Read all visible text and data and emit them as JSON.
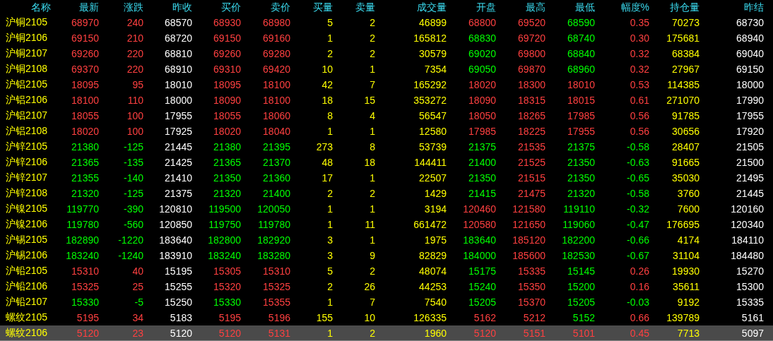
{
  "columns": [
    "名称",
    "最新",
    "涨跌",
    "昨收",
    "买价",
    "卖价",
    "买量",
    "卖量",
    "成交量",
    "开盘",
    "最高",
    "最低",
    "幅度%",
    "持仓量",
    "昨结"
  ],
  "rows": [
    {
      "name": "沪铜2105",
      "selected": false,
      "cells": [
        {
          "text": "68970",
          "color": "#ff4040"
        },
        {
          "text": "240",
          "color": "#ff4040"
        },
        {
          "text": "68570",
          "color": "#ffffff"
        },
        {
          "text": "68930",
          "color": "#ff4040"
        },
        {
          "text": "68980",
          "color": "#ff4040"
        },
        {
          "text": "5",
          "color": "#ffff00"
        },
        {
          "text": "2",
          "color": "#ffff00"
        },
        {
          "text": "46899",
          "color": "#ffff00"
        },
        {
          "text": "68800",
          "color": "#ff4040"
        },
        {
          "text": "69520",
          "color": "#ff4040"
        },
        {
          "text": "68590",
          "color": "#00ff00"
        },
        {
          "text": "0.35",
          "color": "#ff4040"
        },
        {
          "text": "70273",
          "color": "#ffff00"
        },
        {
          "text": "68730",
          "color": "#ffffff"
        }
      ]
    },
    {
      "name": "沪铜2106",
      "selected": false,
      "cells": [
        {
          "text": "69150",
          "color": "#ff4040"
        },
        {
          "text": "210",
          "color": "#ff4040"
        },
        {
          "text": "68720",
          "color": "#ffffff"
        },
        {
          "text": "69150",
          "color": "#ff4040"
        },
        {
          "text": "69160",
          "color": "#ff4040"
        },
        {
          "text": "1",
          "color": "#ffff00"
        },
        {
          "text": "2",
          "color": "#ffff00"
        },
        {
          "text": "165812",
          "color": "#ffff00"
        },
        {
          "text": "68830",
          "color": "#00ff00"
        },
        {
          "text": "69720",
          "color": "#ff4040"
        },
        {
          "text": "68740",
          "color": "#00ff00"
        },
        {
          "text": "0.30",
          "color": "#ff4040"
        },
        {
          "text": "175681",
          "color": "#ffff00"
        },
        {
          "text": "68940",
          "color": "#ffffff"
        }
      ]
    },
    {
      "name": "沪铜2107",
      "selected": false,
      "cells": [
        {
          "text": "69260",
          "color": "#ff4040"
        },
        {
          "text": "220",
          "color": "#ff4040"
        },
        {
          "text": "68810",
          "color": "#ffffff"
        },
        {
          "text": "69260",
          "color": "#ff4040"
        },
        {
          "text": "69280",
          "color": "#ff4040"
        },
        {
          "text": "2",
          "color": "#ffff00"
        },
        {
          "text": "2",
          "color": "#ffff00"
        },
        {
          "text": "30579",
          "color": "#ffff00"
        },
        {
          "text": "69020",
          "color": "#00ff00"
        },
        {
          "text": "69800",
          "color": "#ff4040"
        },
        {
          "text": "68840",
          "color": "#00ff00"
        },
        {
          "text": "0.32",
          "color": "#ff4040"
        },
        {
          "text": "68384",
          "color": "#ffff00"
        },
        {
          "text": "69040",
          "color": "#ffffff"
        }
      ]
    },
    {
      "name": "沪铜2108",
      "selected": false,
      "cells": [
        {
          "text": "69370",
          "color": "#ff4040"
        },
        {
          "text": "220",
          "color": "#ff4040"
        },
        {
          "text": "68910",
          "color": "#ffffff"
        },
        {
          "text": "69310",
          "color": "#ff4040"
        },
        {
          "text": "69420",
          "color": "#ff4040"
        },
        {
          "text": "10",
          "color": "#ffff00"
        },
        {
          "text": "1",
          "color": "#ffff00"
        },
        {
          "text": "7354",
          "color": "#ffff00"
        },
        {
          "text": "69050",
          "color": "#00ff00"
        },
        {
          "text": "69870",
          "color": "#ff4040"
        },
        {
          "text": "68960",
          "color": "#00ff00"
        },
        {
          "text": "0.32",
          "color": "#ff4040"
        },
        {
          "text": "27967",
          "color": "#ffff00"
        },
        {
          "text": "69150",
          "color": "#ffffff"
        }
      ]
    },
    {
      "name": "沪铝2105",
      "selected": false,
      "cells": [
        {
          "text": "18095",
          "color": "#ff4040"
        },
        {
          "text": "95",
          "color": "#ff4040"
        },
        {
          "text": "18010",
          "color": "#ffffff"
        },
        {
          "text": "18095",
          "color": "#ff4040"
        },
        {
          "text": "18100",
          "color": "#ff4040"
        },
        {
          "text": "42",
          "color": "#ffff00"
        },
        {
          "text": "7",
          "color": "#ffff00"
        },
        {
          "text": "165292",
          "color": "#ffff00"
        },
        {
          "text": "18020",
          "color": "#ff4040"
        },
        {
          "text": "18300",
          "color": "#ff4040"
        },
        {
          "text": "18010",
          "color": "#ff4040"
        },
        {
          "text": "0.53",
          "color": "#ff4040"
        },
        {
          "text": "114385",
          "color": "#ffff00"
        },
        {
          "text": "18000",
          "color": "#ffffff"
        }
      ]
    },
    {
      "name": "沪铝2106",
      "selected": false,
      "cells": [
        {
          "text": "18100",
          "color": "#ff4040"
        },
        {
          "text": "110",
          "color": "#ff4040"
        },
        {
          "text": "18000",
          "color": "#ffffff"
        },
        {
          "text": "18090",
          "color": "#ff4040"
        },
        {
          "text": "18100",
          "color": "#ff4040"
        },
        {
          "text": "18",
          "color": "#ffff00"
        },
        {
          "text": "15",
          "color": "#ffff00"
        },
        {
          "text": "353272",
          "color": "#ffff00"
        },
        {
          "text": "18090",
          "color": "#ff4040"
        },
        {
          "text": "18315",
          "color": "#ff4040"
        },
        {
          "text": "18015",
          "color": "#ff4040"
        },
        {
          "text": "0.61",
          "color": "#ff4040"
        },
        {
          "text": "271070",
          "color": "#ffff00"
        },
        {
          "text": "17990",
          "color": "#ffffff"
        }
      ]
    },
    {
      "name": "沪铝2107",
      "selected": false,
      "cells": [
        {
          "text": "18055",
          "color": "#ff4040"
        },
        {
          "text": "100",
          "color": "#ff4040"
        },
        {
          "text": "17955",
          "color": "#ffffff"
        },
        {
          "text": "18055",
          "color": "#ff4040"
        },
        {
          "text": "18060",
          "color": "#ff4040"
        },
        {
          "text": "8",
          "color": "#ffff00"
        },
        {
          "text": "4",
          "color": "#ffff00"
        },
        {
          "text": "56547",
          "color": "#ffff00"
        },
        {
          "text": "18050",
          "color": "#ff4040"
        },
        {
          "text": "18265",
          "color": "#ff4040"
        },
        {
          "text": "17985",
          "color": "#ff4040"
        },
        {
          "text": "0.56",
          "color": "#ff4040"
        },
        {
          "text": "91785",
          "color": "#ffff00"
        },
        {
          "text": "17955",
          "color": "#ffffff"
        }
      ]
    },
    {
      "name": "沪铝2108",
      "selected": false,
      "cells": [
        {
          "text": "18020",
          "color": "#ff4040"
        },
        {
          "text": "100",
          "color": "#ff4040"
        },
        {
          "text": "17925",
          "color": "#ffffff"
        },
        {
          "text": "18020",
          "color": "#ff4040"
        },
        {
          "text": "18040",
          "color": "#ff4040"
        },
        {
          "text": "1",
          "color": "#ffff00"
        },
        {
          "text": "1",
          "color": "#ffff00"
        },
        {
          "text": "12580",
          "color": "#ffff00"
        },
        {
          "text": "17985",
          "color": "#ff4040"
        },
        {
          "text": "18225",
          "color": "#ff4040"
        },
        {
          "text": "17955",
          "color": "#ff4040"
        },
        {
          "text": "0.56",
          "color": "#ff4040"
        },
        {
          "text": "30656",
          "color": "#ffff00"
        },
        {
          "text": "17920",
          "color": "#ffffff"
        }
      ]
    },
    {
      "name": "沪锌2105",
      "selected": false,
      "cells": [
        {
          "text": "21380",
          "color": "#00ff00"
        },
        {
          "text": "-125",
          "color": "#00ff00"
        },
        {
          "text": "21445",
          "color": "#ffffff"
        },
        {
          "text": "21380",
          "color": "#00ff00"
        },
        {
          "text": "21395",
          "color": "#00ff00"
        },
        {
          "text": "273",
          "color": "#ffff00"
        },
        {
          "text": "8",
          "color": "#ffff00"
        },
        {
          "text": "53739",
          "color": "#ffff00"
        },
        {
          "text": "21375",
          "color": "#00ff00"
        },
        {
          "text": "21535",
          "color": "#ff4040"
        },
        {
          "text": "21375",
          "color": "#00ff00"
        },
        {
          "text": "-0.58",
          "color": "#00ff00"
        },
        {
          "text": "28407",
          "color": "#ffff00"
        },
        {
          "text": "21505",
          "color": "#ffffff"
        }
      ]
    },
    {
      "name": "沪锌2106",
      "selected": false,
      "cells": [
        {
          "text": "21365",
          "color": "#00ff00"
        },
        {
          "text": "-135",
          "color": "#00ff00"
        },
        {
          "text": "21425",
          "color": "#ffffff"
        },
        {
          "text": "21365",
          "color": "#00ff00"
        },
        {
          "text": "21370",
          "color": "#00ff00"
        },
        {
          "text": "48",
          "color": "#ffff00"
        },
        {
          "text": "18",
          "color": "#ffff00"
        },
        {
          "text": "144411",
          "color": "#ffff00"
        },
        {
          "text": "21400",
          "color": "#00ff00"
        },
        {
          "text": "21525",
          "color": "#ff4040"
        },
        {
          "text": "21350",
          "color": "#00ff00"
        },
        {
          "text": "-0.63",
          "color": "#00ff00"
        },
        {
          "text": "91665",
          "color": "#ffff00"
        },
        {
          "text": "21500",
          "color": "#ffffff"
        }
      ]
    },
    {
      "name": "沪锌2107",
      "selected": false,
      "cells": [
        {
          "text": "21355",
          "color": "#00ff00"
        },
        {
          "text": "-140",
          "color": "#00ff00"
        },
        {
          "text": "21410",
          "color": "#ffffff"
        },
        {
          "text": "21350",
          "color": "#00ff00"
        },
        {
          "text": "21360",
          "color": "#00ff00"
        },
        {
          "text": "17",
          "color": "#ffff00"
        },
        {
          "text": "1",
          "color": "#ffff00"
        },
        {
          "text": "22507",
          "color": "#ffff00"
        },
        {
          "text": "21350",
          "color": "#00ff00"
        },
        {
          "text": "21515",
          "color": "#ff4040"
        },
        {
          "text": "21350",
          "color": "#00ff00"
        },
        {
          "text": "-0.65",
          "color": "#00ff00"
        },
        {
          "text": "35030",
          "color": "#ffff00"
        },
        {
          "text": "21495",
          "color": "#ffffff"
        }
      ]
    },
    {
      "name": "沪锌2108",
      "selected": false,
      "cells": [
        {
          "text": "21320",
          "color": "#00ff00"
        },
        {
          "text": "-125",
          "color": "#00ff00"
        },
        {
          "text": "21375",
          "color": "#ffffff"
        },
        {
          "text": "21320",
          "color": "#00ff00"
        },
        {
          "text": "21400",
          "color": "#00ff00"
        },
        {
          "text": "2",
          "color": "#ffff00"
        },
        {
          "text": "2",
          "color": "#ffff00"
        },
        {
          "text": "1429",
          "color": "#ffff00"
        },
        {
          "text": "21415",
          "color": "#00ff00"
        },
        {
          "text": "21475",
          "color": "#ff4040"
        },
        {
          "text": "21320",
          "color": "#00ff00"
        },
        {
          "text": "-0.58",
          "color": "#00ff00"
        },
        {
          "text": "3760",
          "color": "#ffff00"
        },
        {
          "text": "21445",
          "color": "#ffffff"
        }
      ]
    },
    {
      "name": "沪镍2105",
      "selected": false,
      "cells": [
        {
          "text": "119770",
          "color": "#00ff00"
        },
        {
          "text": "-390",
          "color": "#00ff00"
        },
        {
          "text": "120810",
          "color": "#ffffff"
        },
        {
          "text": "119500",
          "color": "#00ff00"
        },
        {
          "text": "120050",
          "color": "#00ff00"
        },
        {
          "text": "1",
          "color": "#ffff00"
        },
        {
          "text": "1",
          "color": "#ffff00"
        },
        {
          "text": "3194",
          "color": "#ffff00"
        },
        {
          "text": "120460",
          "color": "#ff4040"
        },
        {
          "text": "121580",
          "color": "#ff4040"
        },
        {
          "text": "119110",
          "color": "#00ff00"
        },
        {
          "text": "-0.32",
          "color": "#00ff00"
        },
        {
          "text": "7600",
          "color": "#ffff00"
        },
        {
          "text": "120160",
          "color": "#ffffff"
        }
      ]
    },
    {
      "name": "沪镍2106",
      "selected": false,
      "cells": [
        {
          "text": "119780",
          "color": "#00ff00"
        },
        {
          "text": "-560",
          "color": "#00ff00"
        },
        {
          "text": "120850",
          "color": "#ffffff"
        },
        {
          "text": "119750",
          "color": "#00ff00"
        },
        {
          "text": "119780",
          "color": "#00ff00"
        },
        {
          "text": "1",
          "color": "#ffff00"
        },
        {
          "text": "11",
          "color": "#ffff00"
        },
        {
          "text": "661472",
          "color": "#ffff00"
        },
        {
          "text": "120580",
          "color": "#ff4040"
        },
        {
          "text": "121650",
          "color": "#ff4040"
        },
        {
          "text": "119060",
          "color": "#00ff00"
        },
        {
          "text": "-0.47",
          "color": "#00ff00"
        },
        {
          "text": "176695",
          "color": "#ffff00"
        },
        {
          "text": "120340",
          "color": "#ffffff"
        }
      ]
    },
    {
      "name": "沪锡2105",
      "selected": false,
      "cells": [
        {
          "text": "182890",
          "color": "#00ff00"
        },
        {
          "text": "-1220",
          "color": "#00ff00"
        },
        {
          "text": "183640",
          "color": "#ffffff"
        },
        {
          "text": "182800",
          "color": "#00ff00"
        },
        {
          "text": "182920",
          "color": "#00ff00"
        },
        {
          "text": "3",
          "color": "#ffff00"
        },
        {
          "text": "1",
          "color": "#ffff00"
        },
        {
          "text": "1975",
          "color": "#ffff00"
        },
        {
          "text": "183640",
          "color": "#00ff00"
        },
        {
          "text": "185120",
          "color": "#ff4040"
        },
        {
          "text": "182200",
          "color": "#00ff00"
        },
        {
          "text": "-0.66",
          "color": "#00ff00"
        },
        {
          "text": "4174",
          "color": "#ffff00"
        },
        {
          "text": "184110",
          "color": "#ffffff"
        }
      ]
    },
    {
      "name": "沪锡2106",
      "selected": false,
      "cells": [
        {
          "text": "183240",
          "color": "#00ff00"
        },
        {
          "text": "-1240",
          "color": "#00ff00"
        },
        {
          "text": "183910",
          "color": "#ffffff"
        },
        {
          "text": "183240",
          "color": "#00ff00"
        },
        {
          "text": "183280",
          "color": "#00ff00"
        },
        {
          "text": "3",
          "color": "#ffff00"
        },
        {
          "text": "9",
          "color": "#ffff00"
        },
        {
          "text": "82829",
          "color": "#ffff00"
        },
        {
          "text": "184000",
          "color": "#00ff00"
        },
        {
          "text": "185600",
          "color": "#ff4040"
        },
        {
          "text": "182530",
          "color": "#00ff00"
        },
        {
          "text": "-0.67",
          "color": "#00ff00"
        },
        {
          "text": "31104",
          "color": "#ffff00"
        },
        {
          "text": "184480",
          "color": "#ffffff"
        }
      ]
    },
    {
      "name": "沪铅2105",
      "selected": false,
      "cells": [
        {
          "text": "15310",
          "color": "#ff4040"
        },
        {
          "text": "40",
          "color": "#ff4040"
        },
        {
          "text": "15195",
          "color": "#ffffff"
        },
        {
          "text": "15305",
          "color": "#ff4040"
        },
        {
          "text": "15310",
          "color": "#ff4040"
        },
        {
          "text": "5",
          "color": "#ffff00"
        },
        {
          "text": "2",
          "color": "#ffff00"
        },
        {
          "text": "48074",
          "color": "#ffff00"
        },
        {
          "text": "15175",
          "color": "#00ff00"
        },
        {
          "text": "15335",
          "color": "#ff4040"
        },
        {
          "text": "15145",
          "color": "#00ff00"
        },
        {
          "text": "0.26",
          "color": "#ff4040"
        },
        {
          "text": "19930",
          "color": "#ffff00"
        },
        {
          "text": "15270",
          "color": "#ffffff"
        }
      ]
    },
    {
      "name": "沪铅2106",
      "selected": false,
      "cells": [
        {
          "text": "15325",
          "color": "#ff4040"
        },
        {
          "text": "25",
          "color": "#ff4040"
        },
        {
          "text": "15255",
          "color": "#ffffff"
        },
        {
          "text": "15320",
          "color": "#ff4040"
        },
        {
          "text": "15325",
          "color": "#ff4040"
        },
        {
          "text": "2",
          "color": "#ffff00"
        },
        {
          "text": "26",
          "color": "#ffff00"
        },
        {
          "text": "44253",
          "color": "#ffff00"
        },
        {
          "text": "15240",
          "color": "#00ff00"
        },
        {
          "text": "15350",
          "color": "#ff4040"
        },
        {
          "text": "15200",
          "color": "#00ff00"
        },
        {
          "text": "0.16",
          "color": "#ff4040"
        },
        {
          "text": "35611",
          "color": "#ffff00"
        },
        {
          "text": "15300",
          "color": "#ffffff"
        }
      ]
    },
    {
      "name": "沪铅2107",
      "selected": false,
      "cells": [
        {
          "text": "15330",
          "color": "#00ff00"
        },
        {
          "text": "-5",
          "color": "#00ff00"
        },
        {
          "text": "15250",
          "color": "#ffffff"
        },
        {
          "text": "15330",
          "color": "#00ff00"
        },
        {
          "text": "15355",
          "color": "#ff4040"
        },
        {
          "text": "1",
          "color": "#ffff00"
        },
        {
          "text": "7",
          "color": "#ffff00"
        },
        {
          "text": "7540",
          "color": "#ffff00"
        },
        {
          "text": "15205",
          "color": "#00ff00"
        },
        {
          "text": "15370",
          "color": "#ff4040"
        },
        {
          "text": "15205",
          "color": "#00ff00"
        },
        {
          "text": "-0.03",
          "color": "#00ff00"
        },
        {
          "text": "9192",
          "color": "#ffff00"
        },
        {
          "text": "15335",
          "color": "#ffffff"
        }
      ]
    },
    {
      "name": "螺纹2105",
      "selected": false,
      "cells": [
        {
          "text": "5195",
          "color": "#ff4040"
        },
        {
          "text": "34",
          "color": "#ff4040"
        },
        {
          "text": "5183",
          "color": "#ffffff"
        },
        {
          "text": "5195",
          "color": "#ff4040"
        },
        {
          "text": "5196",
          "color": "#ff4040"
        },
        {
          "text": "155",
          "color": "#ffff00"
        },
        {
          "text": "10",
          "color": "#ffff00"
        },
        {
          "text": "126335",
          "color": "#ffff00"
        },
        {
          "text": "5162",
          "color": "#ff4040"
        },
        {
          "text": "5212",
          "color": "#ff4040"
        },
        {
          "text": "5152",
          "color": "#00ff00"
        },
        {
          "text": "0.66",
          "color": "#ff4040"
        },
        {
          "text": "139789",
          "color": "#ffff00"
        },
        {
          "text": "5161",
          "color": "#ffffff"
        }
      ]
    },
    {
      "name": "螺纹2106",
      "selected": true,
      "cells": [
        {
          "text": "5120",
          "color": "#ff4040"
        },
        {
          "text": "23",
          "color": "#ff4040"
        },
        {
          "text": "5120",
          "color": "#ffffff"
        },
        {
          "text": "5120",
          "color": "#ff4040"
        },
        {
          "text": "5131",
          "color": "#ff4040"
        },
        {
          "text": "1",
          "color": "#ffff00"
        },
        {
          "text": "2",
          "color": "#ffff00"
        },
        {
          "text": "1960",
          "color": "#ffff00"
        },
        {
          "text": "5120",
          "color": "#ff4040"
        },
        {
          "text": "5151",
          "color": "#ff4040"
        },
        {
          "text": "5101",
          "color": "#ff4040"
        },
        {
          "text": "0.45",
          "color": "#ff4040"
        },
        {
          "text": "7713",
          "color": "#ffff00"
        },
        {
          "text": "5097",
          "color": "#ffffff"
        }
      ]
    }
  ]
}
